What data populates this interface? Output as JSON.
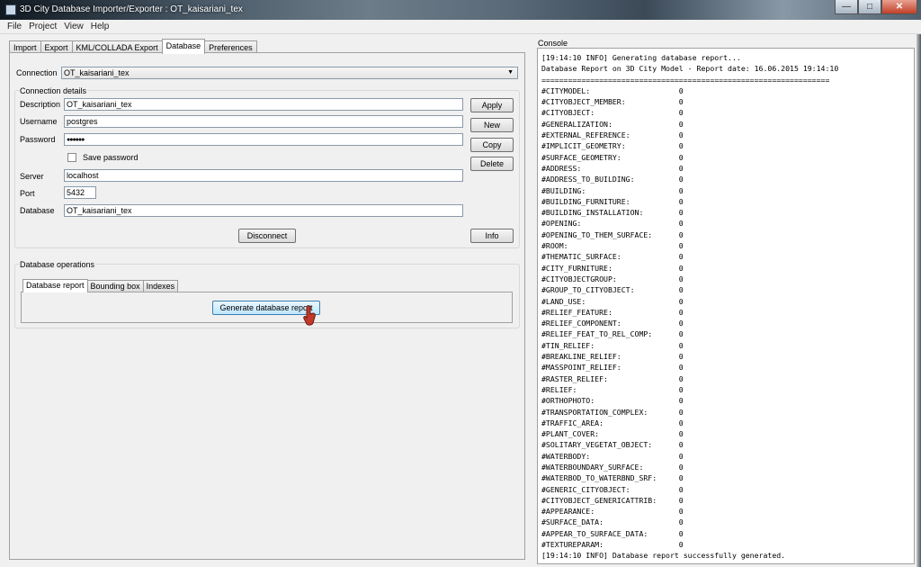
{
  "window": {
    "title": "3D City Database Importer/Exporter : OT_kaisariani_tex",
    "min_glyph": "—",
    "max_glyph": "□",
    "close_glyph": "✕"
  },
  "menu": [
    "File",
    "Project",
    "View",
    "Help"
  ],
  "tabs": [
    "Import",
    "Export",
    "KML/COLLADA Export",
    "Database",
    "Preferences"
  ],
  "connection": {
    "label": "Connection",
    "value": "OT_kaisariani_tex",
    "details_title": "Connection details",
    "description_label": "Description",
    "description_value": "OT_kaisariani_tex",
    "username_label": "Username",
    "username_value": "postgres",
    "password_label": "Password",
    "password_value": "●●●●●●",
    "save_password_label": "Save password",
    "server_label": "Server",
    "server_value": "localhost",
    "port_label": "Port",
    "port_value": "5432",
    "database_label": "Database",
    "database_value": "OT_kaisariani_tex"
  },
  "buttons": {
    "apply": "Apply",
    "new": "New",
    "copy": "Copy",
    "delete": "Delete",
    "disconnect": "Disconnect",
    "info": "Info",
    "generate_report": "Generate database report"
  },
  "db_operations": {
    "title": "Database operations",
    "tabs": [
      "Database report",
      "Bounding box",
      "Indexes"
    ]
  },
  "console": {
    "title": "Console",
    "lines": [
      "[19:14:10 INFO] Generating database report...",
      "Database Report on 3D City Model - Report date: 16.06.2015 19:14:10",
      "=================================================================",
      "#CITYMODEL:                    0",
      "#CITYOBJECT_MEMBER:            0",
      "#CITYOBJECT:                   0",
      "#GENERALIZATION:               0",
      "#EXTERNAL_REFERENCE:           0",
      "#IMPLICIT_GEOMETRY:            0",
      "#SURFACE_GEOMETRY:             0",
      "#ADDRESS:                      0",
      "#ADDRESS_TO_BUILDING:          0",
      "#BUILDING:                     0",
      "#BUILDING_FURNITURE:           0",
      "#BUILDING_INSTALLATION:        0",
      "#OPENING:                      0",
      "#OPENING_TO_THEM_SURFACE:      0",
      "#ROOM:                         0",
      "#THEMATIC_SURFACE:             0",
      "#CITY_FURNITURE:               0",
      "#CITYOBJECTGROUP:              0",
      "#GROUP_TO_CITYOBJECT:          0",
      "#LAND_USE:                     0",
      "#RELIEF_FEATURE:               0",
      "#RELIEF_COMPONENT:             0",
      "#RELIEF_FEAT_TO_REL_COMP:      0",
      "#TIN_RELIEF:                   0",
      "#BREAKLINE_RELIEF:             0",
      "#MASSPOINT_RELIEF:             0",
      "#RASTER_RELIEF:                0",
      "#RELIEF:                       0",
      "#ORTHOPHOTO:                   0",
      "#TRANSPORTATION_COMPLEX:       0",
      "#TRAFFIC_AREA:                 0",
      "#PLANT_COVER:                  0",
      "#SOLITARY_VEGETAT_OBJECT:      0",
      "#WATERBODY:                    0",
      "#WATERBOUNDARY_SURFACE:        0",
      "#WATERBOD_TO_WATERBND_SRF:     0",
      "#GENERIC_CITYOBJECT:           0",
      "#CITYOBJECT_GENERICATTRIB:     0",
      "#APPEARANCE:                   0",
      "#SURFACE_DATA:                 0",
      "#APPEAR_TO_SURFACE_DATA:       0",
      "#TEXTUREPARAM:                 0",
      "[19:14:10 INFO] Database report successfully generated."
    ]
  }
}
